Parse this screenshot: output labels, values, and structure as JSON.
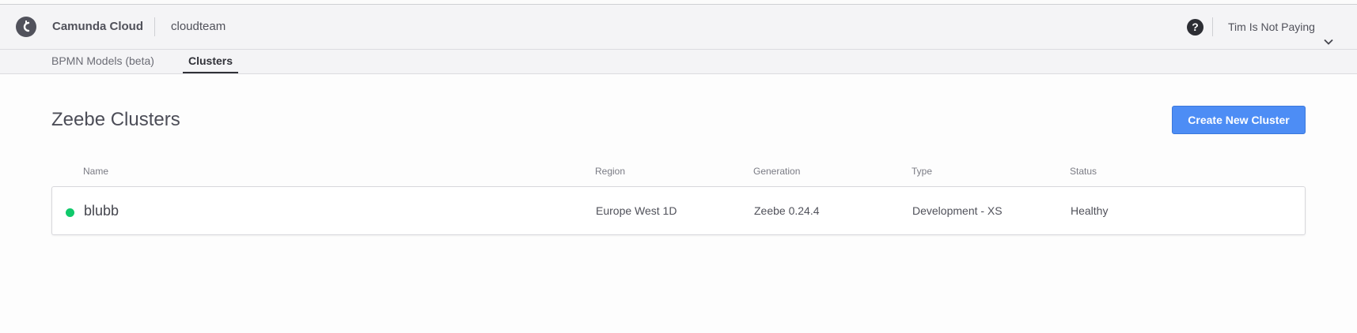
{
  "header": {
    "brand": "Camunda Cloud",
    "org": "cloudteam",
    "help_glyph": "?",
    "user": "Tim Is Not Paying"
  },
  "tabs": [
    {
      "label": "BPMN Models (beta)",
      "active": false
    },
    {
      "label": "Clusters",
      "active": true
    }
  ],
  "main": {
    "title": "Zeebe Clusters",
    "create_button": "Create New Cluster"
  },
  "table": {
    "columns": [
      "Name",
      "Region",
      "Generation",
      "Type",
      "Status"
    ],
    "rows": [
      {
        "name": "blubb",
        "region": "Europe West 1D",
        "generation": "Zeebe 0.24.4",
        "type": "Development - XS",
        "status": "Healthy",
        "status_color": "#10c96b"
      }
    ]
  },
  "colors": {
    "accent": "#4d8df5",
    "healthy": "#10c96b"
  },
  "icons": {
    "logo": "camunda-logo-icon",
    "help": "help-icon",
    "user_menu": "chevron-down-icon",
    "status": "status-dot-icon"
  }
}
